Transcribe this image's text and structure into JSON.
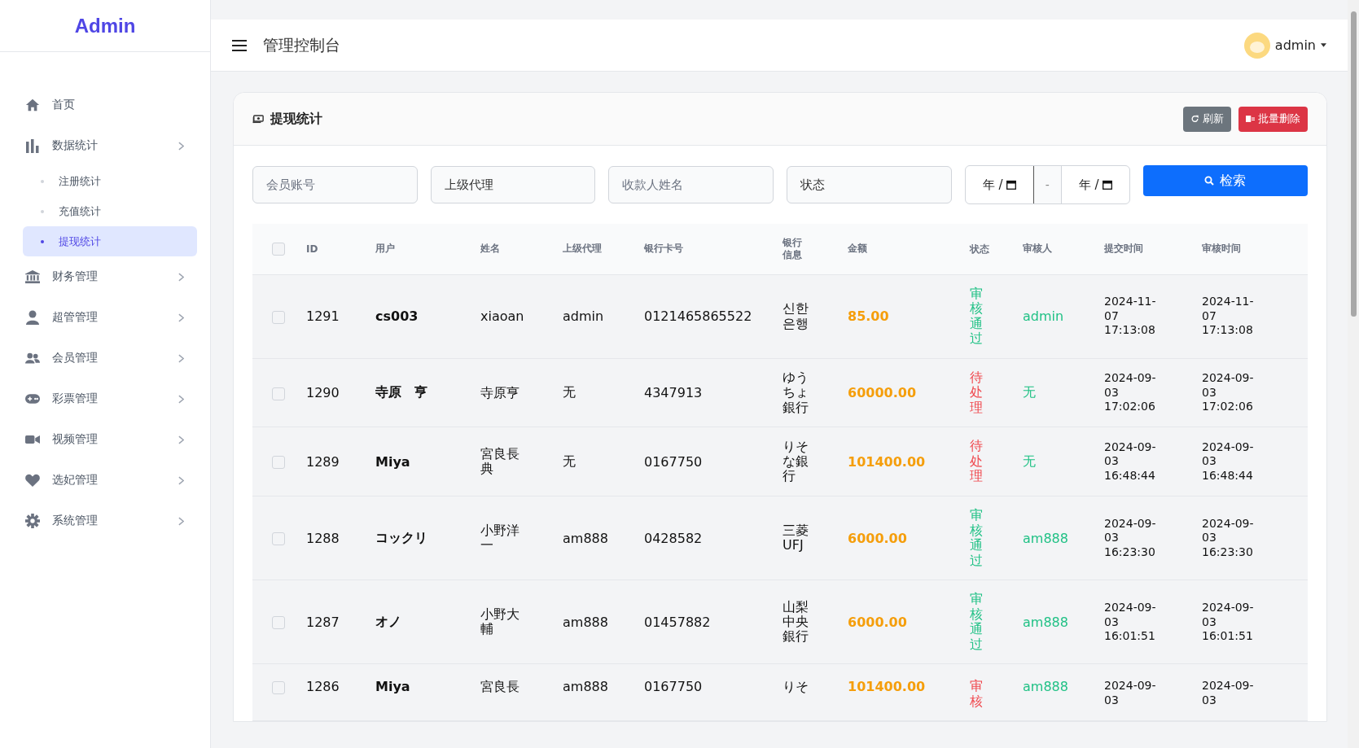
{
  "brand": "Admin",
  "sidebar": {
    "items": [
      {
        "label": "首页",
        "kind": "home",
        "selected": false
      },
      {
        "label": "数据统计",
        "kind": "chart",
        "selected": false,
        "expanded": true,
        "children": [
          {
            "label": "注册统计",
            "selected": false
          },
          {
            "label": "充值统计",
            "selected": false
          },
          {
            "label": "提现统计",
            "selected": true
          }
        ]
      },
      {
        "label": "财务管理",
        "kind": "bank",
        "selected": false,
        "expanded": false
      },
      {
        "label": "超管管理",
        "kind": "user",
        "selected": false,
        "expanded": false
      },
      {
        "label": "会员管理",
        "kind": "users",
        "selected": false,
        "expanded": false
      },
      {
        "label": "彩票管理",
        "kind": "gamepad",
        "selected": false,
        "expanded": false
      },
      {
        "label": "视频管理",
        "kind": "video",
        "selected": false,
        "expanded": false
      },
      {
        "label": "选妃管理",
        "kind": "heart",
        "selected": false,
        "expanded": false
      },
      {
        "label": "系统管理",
        "kind": "gear",
        "selected": false,
        "expanded": false
      }
    ]
  },
  "header": {
    "title": "管理控制台",
    "user": "admin"
  },
  "card": {
    "title": "提现统计",
    "buttons": [
      {
        "label": "刷新",
        "kind": "refresh"
      },
      {
        "label": "批量删除",
        "kind": "delete"
      }
    ]
  },
  "filters": [
    {
      "kind": "input",
      "placeholder": "会员账号"
    },
    {
      "kind": "select",
      "value": "上级代理"
    },
    {
      "kind": "input",
      "placeholder": "收款人姓名"
    },
    {
      "kind": "select",
      "value": "状态"
    }
  ],
  "date_range": {
    "from": "年 /",
    "separator": "-",
    "to": "年 /"
  },
  "search_button": "检索",
  "table": {
    "select_all_checked": false,
    "columns": [
      "ID",
      "用户",
      "姓名",
      "上级代理",
      "银行卡号",
      "银行信息",
      "金额",
      "状态",
      "审核人",
      "提交时间",
      "审核时间"
    ],
    "rows": [
      {
        "checked": false,
        "id": "1291",
        "user": "cs003",
        "name": "xiaoan",
        "agent": "admin",
        "card": "0121465865522",
        "bank": "신한은행",
        "amount": "85.00",
        "status": "审核通过",
        "color": "#20c185",
        "reviewer": "admin",
        "submitted": "2024-11-07 17:13:08",
        "reviewed": "2024-11-07 17:13:08"
      },
      {
        "checked": false,
        "id": "1290",
        "user": "寺原　亨",
        "name": "寺原亨",
        "agent": "无",
        "card": "4347913",
        "bank": "ゆうちょ銀行",
        "amount": "60000.00",
        "status": "待处理",
        "color": "#f0484e",
        "reviewer": "无",
        "submitted": "2024-09-03 17:02:06",
        "reviewed": "2024-09-03 17:02:06"
      },
      {
        "checked": false,
        "id": "1289",
        "user": "Miya",
        "name": "宮良長典",
        "agent": "无",
        "card": "0167750",
        "bank": "りそな銀行",
        "amount": "101400.00",
        "status": "待处理",
        "color": "#f0484e",
        "reviewer": "无",
        "submitted": "2024-09-03 16:48:44",
        "reviewed": "2024-09-03 16:48:44"
      },
      {
        "checked": false,
        "id": "1288",
        "user": "コックリ",
        "name": "小野洋一",
        "agent": "am888",
        "card": "0428582",
        "bank": "三菱UFJ",
        "amount": "6000.00",
        "status": "审核通过",
        "color": "#20c185",
        "reviewer": "am888",
        "submitted": "2024-09-03 16:23:30",
        "reviewed": "2024-09-03 16:23:30"
      },
      {
        "checked": false,
        "id": "1287",
        "user": "オノ",
        "name": "小野大輔",
        "agent": "am888",
        "card": "01457882",
        "bank": "山梨中央銀行",
        "amount": "6000.00",
        "status": "审核通过",
        "color": "#20c185",
        "reviewer": "am888",
        "submitted": "2024-09-03 16:01:51",
        "reviewed": "2024-09-03 16:01:51"
      },
      {
        "checked": false,
        "id": "1286",
        "user": "Miya",
        "name": "宮良長",
        "agent": "am888",
        "card": "0167750",
        "bank": "りそ",
        "amount": "101400.00",
        "status": "审核",
        "color": "#f0484e",
        "reviewer": "am888",
        "submitted": "2024-09-03",
        "reviewed": "2024-09-03"
      }
    ]
  }
}
